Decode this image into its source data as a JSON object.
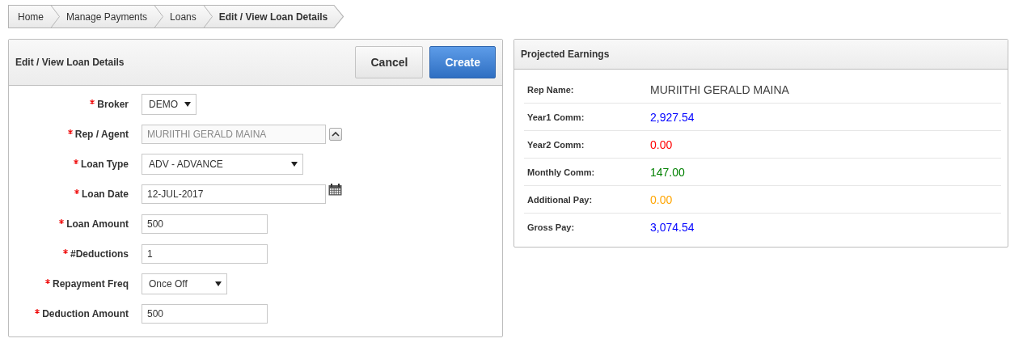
{
  "breadcrumb": [
    {
      "label": "Home",
      "selected": false
    },
    {
      "label": "Manage Payments",
      "selected": false
    },
    {
      "label": "Loans",
      "selected": false
    },
    {
      "label": "Edit / View Loan Details",
      "selected": true
    }
  ],
  "form": {
    "title": "Edit / View Loan Details",
    "buttons": [
      {
        "label": "Cancel",
        "kind": "secondary"
      },
      {
        "label": "Create",
        "kind": "primary"
      }
    ],
    "fields": [
      {
        "label": "Broker",
        "kind": "select",
        "value": "DEMO",
        "readonly": false,
        "required": true
      },
      {
        "label": "Rep / Agent",
        "kind": "lookup",
        "value": "MURIITHI GERALD MAINA",
        "readonly": true,
        "required": true
      },
      {
        "label": "Loan Type",
        "kind": "select",
        "value": "ADV - ADVANCE",
        "readonly": false,
        "required": true
      },
      {
        "label": "Loan Date",
        "kind": "date",
        "value": "12-JUL-2017",
        "readonly": false,
        "required": true
      },
      {
        "label": "Loan Amount",
        "kind": "text",
        "value": "500",
        "readonly": false,
        "required": true
      },
      {
        "label": "#Deductions",
        "kind": "text",
        "value": "1",
        "readonly": false,
        "required": true
      },
      {
        "label": "Repayment Freq",
        "kind": "select",
        "value": "Once Off",
        "readonly": false,
        "required": true
      },
      {
        "label": "Deduction Amount",
        "kind": "text",
        "value": "500",
        "readonly": false,
        "required": true
      }
    ]
  },
  "earnings": {
    "title": "Projected Earnings",
    "rows": [
      {
        "label": "Rep Name:",
        "value": "MURIITHI GERALD MAINA",
        "color": "#404040"
      },
      {
        "label": "Year1 Comm:",
        "value": "2,927.54",
        "color": "#0000ff"
      },
      {
        "label": "Year2 Comm:",
        "value": "0.00",
        "color": "#ff0000"
      },
      {
        "label": "Monthly Comm:",
        "value": "147.00",
        "color": "#008000"
      },
      {
        "label": "Additional Pay:",
        "value": "0.00",
        "color": "#ffa500"
      },
      {
        "label": "Gross Pay:",
        "value": "3,074.54",
        "color": "#0000ff"
      }
    ]
  }
}
